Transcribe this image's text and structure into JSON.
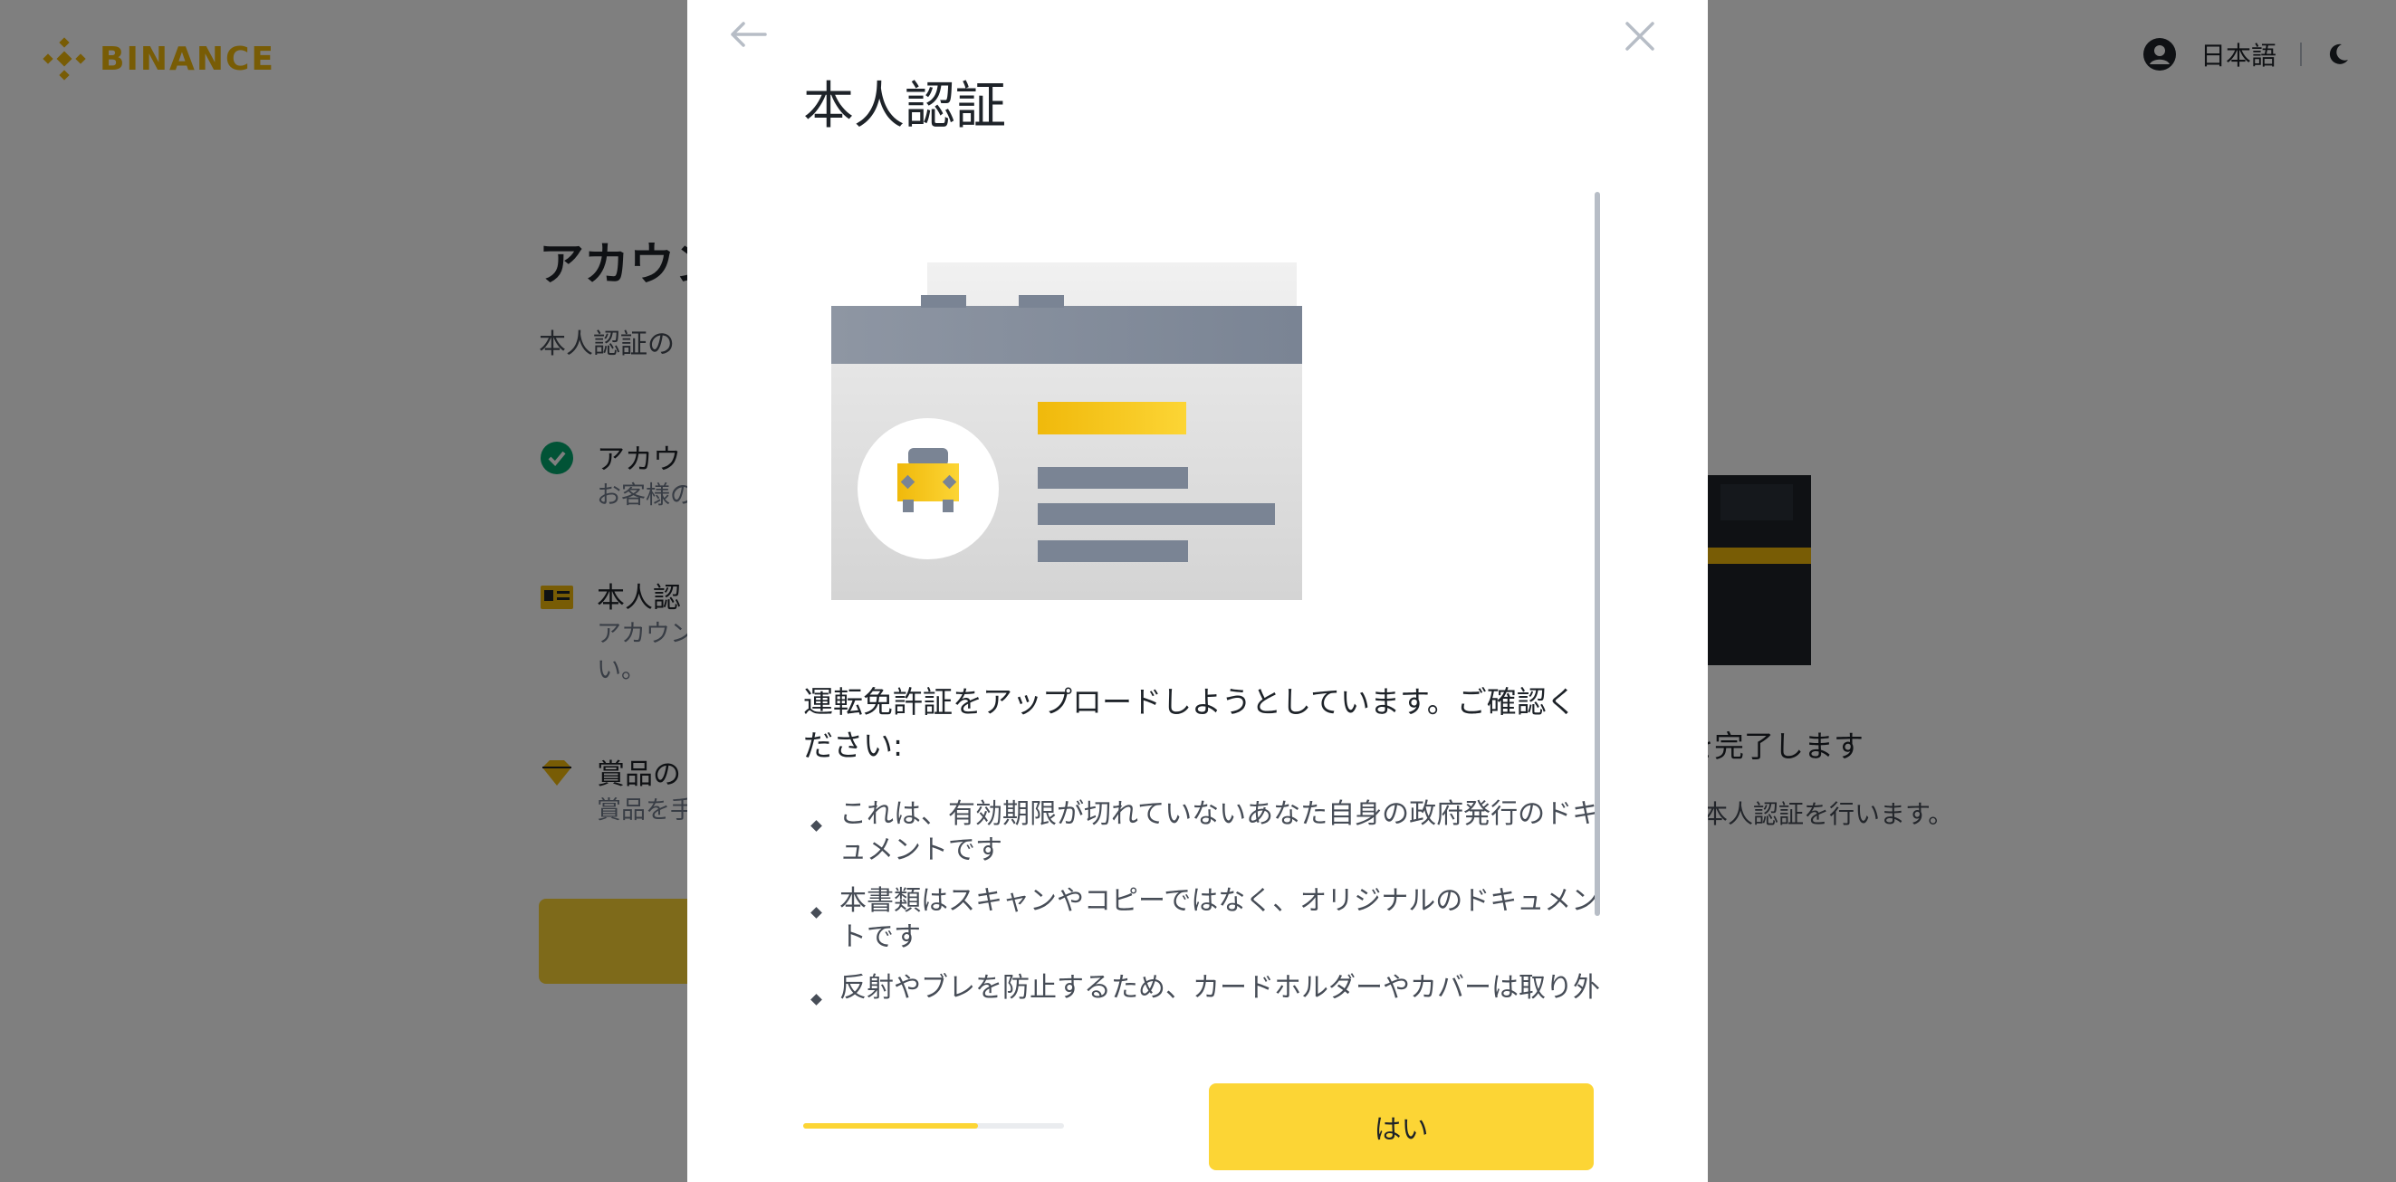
{
  "brand": {
    "name": "BINANCE",
    "color": "#F0B90B"
  },
  "header": {
    "language": "日本語",
    "user_icon": "user-circle-icon",
    "theme_icon": "moon-icon"
  },
  "background": {
    "title": "アカウン",
    "subtitle": "本人認証の",
    "steps": [
      {
        "title": "アカウ",
        "desc": "お客様の",
        "icon": "check-circle-icon"
      },
      {
        "title": "本人認",
        "desc": "アカウン\nい。",
        "icon": "id-card-icon"
      },
      {
        "title": "賞品の",
        "desc": "賞品を手",
        "icon": "gem-icon"
      }
    ],
    "right_title": "を完了します",
    "right_desc": "本人認証を行います。"
  },
  "modal": {
    "title": "本人認証",
    "back_icon": "arrow-left-icon",
    "close_icon": "close-icon",
    "illustration": "drivers-license-illustration",
    "question": "運転免許証をアップロードしようとしています。ご確認ください:",
    "bullets": [
      "これは、有効期限が切れていないあなた自身の政府発行のドキュメントです",
      "本書類はスキャンやコピーではなく、オリジナルのドキュメントです",
      "反射やブレを防止するため、カードホルダーやカバーは取り外し"
    ],
    "progress": 0.67,
    "confirm_label": "はい",
    "accent": "#FCD535"
  }
}
